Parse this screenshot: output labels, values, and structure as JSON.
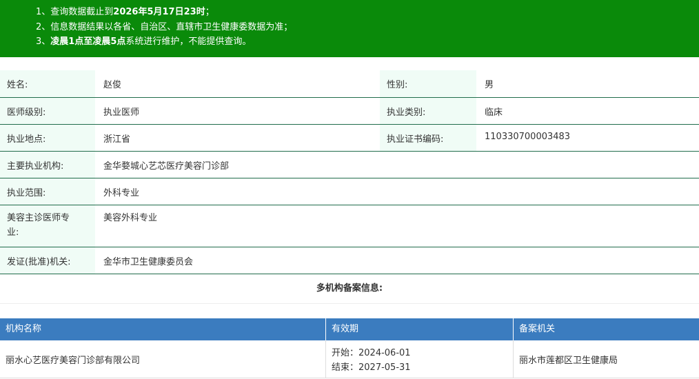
{
  "notice": {
    "line1_prefix": "1、查询数据截止到",
    "line1_bold": "2026年5月17日23时",
    "line1_suffix": "；",
    "line2": "2、信息数据结果以各省、自治区、直辖市卫生健康委数据为准；",
    "line3_prefix": "3、",
    "line3_bold": "凌晨1点至凌晨5点",
    "line3_suffix": "系统进行维护，不能提供查询。"
  },
  "info": {
    "name_label": "姓名:",
    "name": "赵俊",
    "gender_label": "性别:",
    "gender": "男",
    "level_label": "医师级别:",
    "level": "执业医师",
    "category_label": "执业类别:",
    "category": "临床",
    "location_label": "执业地点:",
    "location": "浙江省",
    "cert_label": "执业证书编码:",
    "cert": "110330700003483",
    "org_label": "主要执业机构:",
    "org": "金华婺城心艺芯医疗美容门诊部",
    "scope_label": "执业范围:",
    "scope": "外科专业",
    "beauty_label_1": "美容主诊医师专",
    "beauty_label_2": "业:",
    "beauty": "美容外科专业",
    "issuer_label": "发证(批准)机关:",
    "issuer": "金华市卫生健康委员会"
  },
  "multi": {
    "title": "多机构备案信息:",
    "headers": [
      "机构名称",
      "有效期",
      "备案机关"
    ],
    "rows": [
      {
        "org": "丽水心艺医疗美容门诊部有限公司",
        "start": "开始：2024-06-01",
        "end": "结束：2027-05-31",
        "authority": "丽水市莲都区卫生健康局"
      }
    ]
  }
}
